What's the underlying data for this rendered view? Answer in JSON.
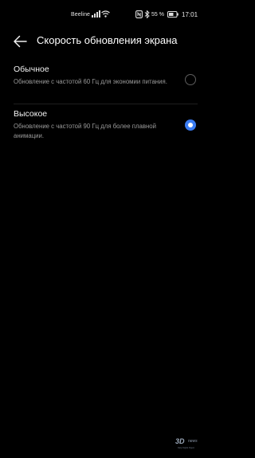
{
  "status_bar": {
    "carrier": "Beeline",
    "battery": "55 %",
    "time": "17:01",
    "icons": [
      "signal-icon",
      "wifi-icon",
      "nfc-icon",
      "bluetooth-icon",
      "battery-icon"
    ]
  },
  "toolbar": {
    "back_icon": "arrow-left-icon",
    "title": "Скорость обновления экрана"
  },
  "options": [
    {
      "title": "Обычное",
      "description": "Обновление с частотой 60 Гц для экономии питания.",
      "selected": false
    },
    {
      "title": "Высокое",
      "description": "Обновление с частотой 90 Гц для более плавной анимации.",
      "selected": true
    }
  ],
  "colors": {
    "accent": "#3a7cf2",
    "background": "#000000"
  },
  "watermark": {
    "brand": "3D",
    "suffix": "news",
    "tagline": "Daily Digital Digest"
  }
}
